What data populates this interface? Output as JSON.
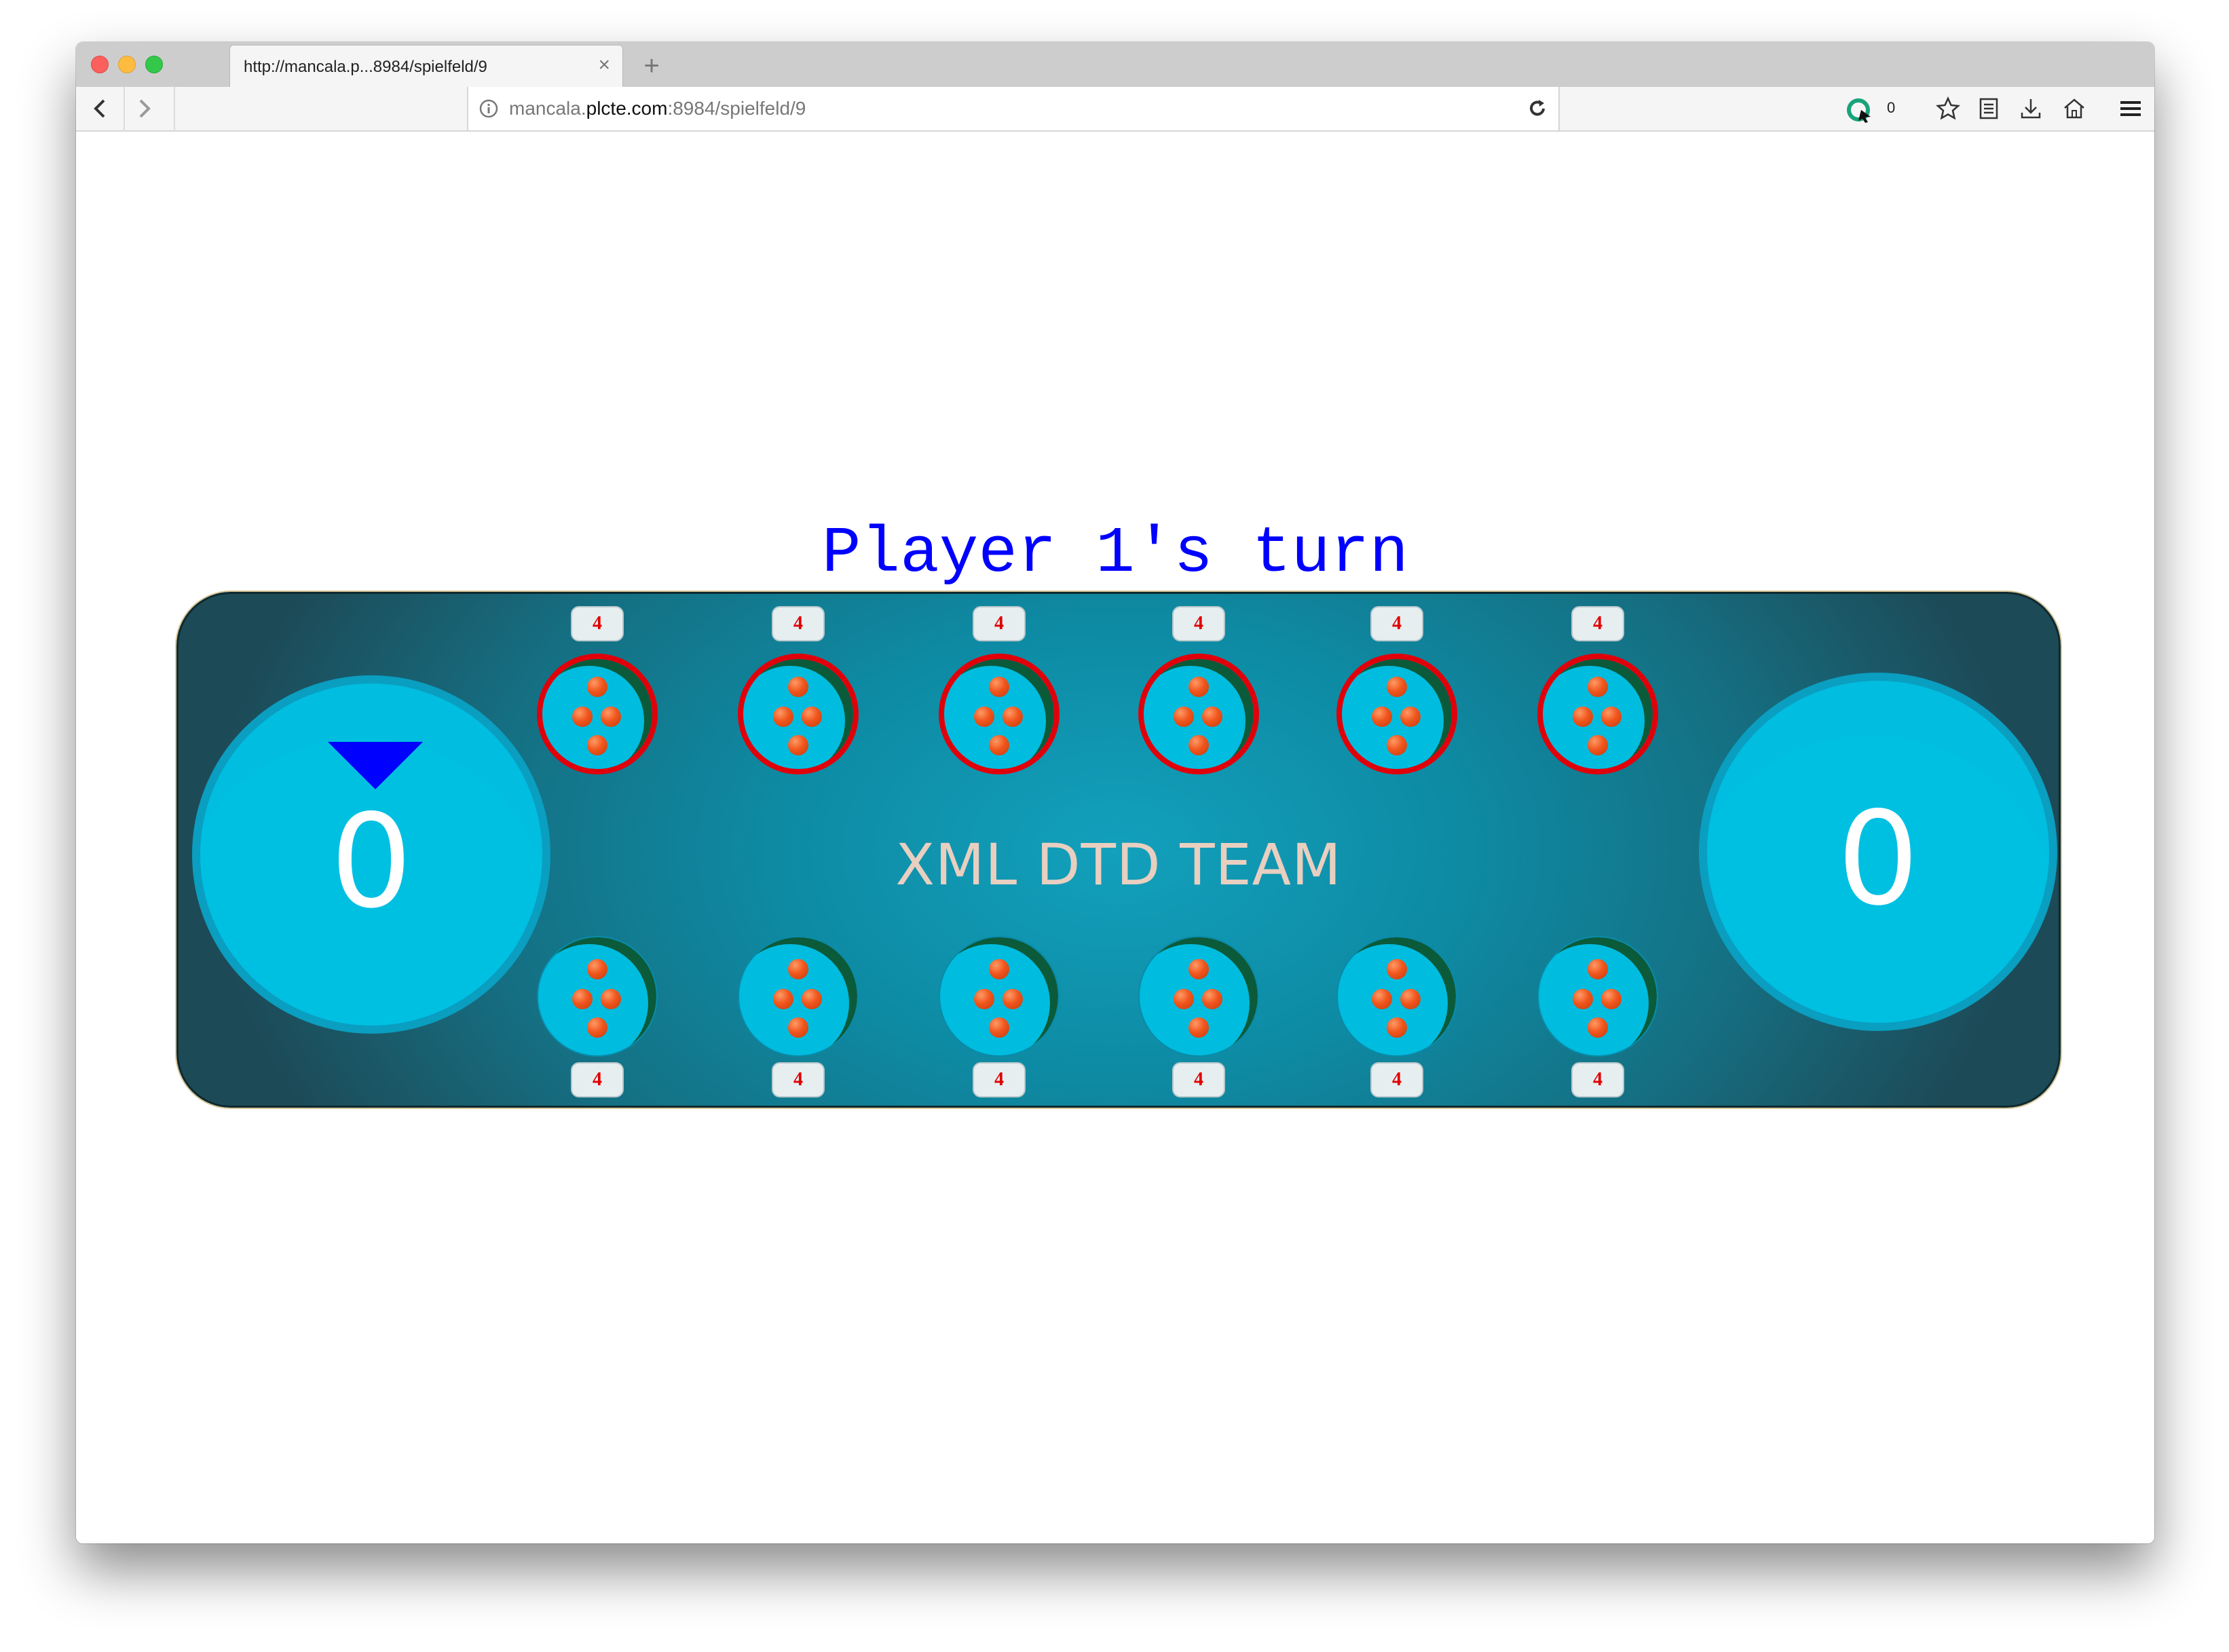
{
  "browser": {
    "tab_title": "http://mancala.p...8984/spielfeld/9",
    "tab_close": "×",
    "new_tab": "+",
    "url_prefix": "mancala.",
    "url_domain": "plcte.com",
    "url_suffix": ":8984/spielfeld/9",
    "extension_count": "0"
  },
  "game": {
    "status": "Player 1's turn",
    "team_name": "XML DTD TEAM",
    "store_left": "0",
    "store_right": "0",
    "top_pits": [
      {
        "count": "4",
        "seeds": 4
      },
      {
        "count": "4",
        "seeds": 4
      },
      {
        "count": "4",
        "seeds": 4
      },
      {
        "count": "4",
        "seeds": 4
      },
      {
        "count": "4",
        "seeds": 4
      },
      {
        "count": "4",
        "seeds": 4
      }
    ],
    "bottom_pits": [
      {
        "count": "4",
        "seeds": 4
      },
      {
        "count": "4",
        "seeds": 4
      },
      {
        "count": "4",
        "seeds": 4
      },
      {
        "count": "4",
        "seeds": 4
      },
      {
        "count": "4",
        "seeds": 4
      },
      {
        "count": "4",
        "seeds": 4
      }
    ],
    "colors": {
      "status_text": "#0000ff",
      "active_pit_border": "#e0000a",
      "seed": "#f0561d",
      "pit": "#00bcdf",
      "board_dark": "#1d4a57"
    }
  }
}
